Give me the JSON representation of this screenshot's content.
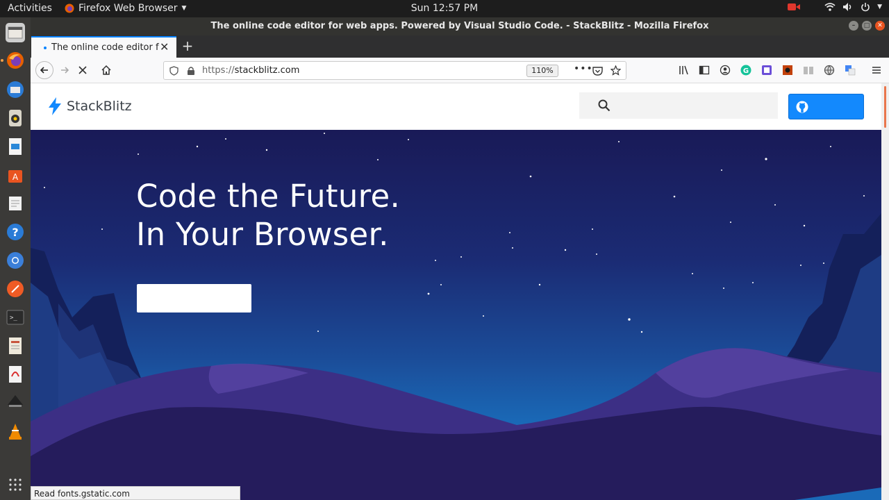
{
  "topbar": {
    "activities": "Activities",
    "app_name": "Firefox Web Browser",
    "clock": "Sun 12:57 PM"
  },
  "window": {
    "title": "The online code editor for web apps. Powered by Visual Studio Code. - StackBlitz - Mozilla Firefox"
  },
  "tab": {
    "label": "The online code editor fo"
  },
  "navbar": {
    "url_scheme": "https://",
    "url_host": "stackblitz.com",
    "zoom": "110%"
  },
  "site": {
    "brand": "StackBlitz",
    "headline_line1": "Code the Future.",
    "headline_line2": "In Your Browser."
  },
  "status": {
    "text": "Read fonts.gstatic.com"
  },
  "colors": {
    "brand_blue": "#1389fd",
    "ubuntu_orange": "#e95420",
    "tab_accent": "#0a84ff"
  }
}
